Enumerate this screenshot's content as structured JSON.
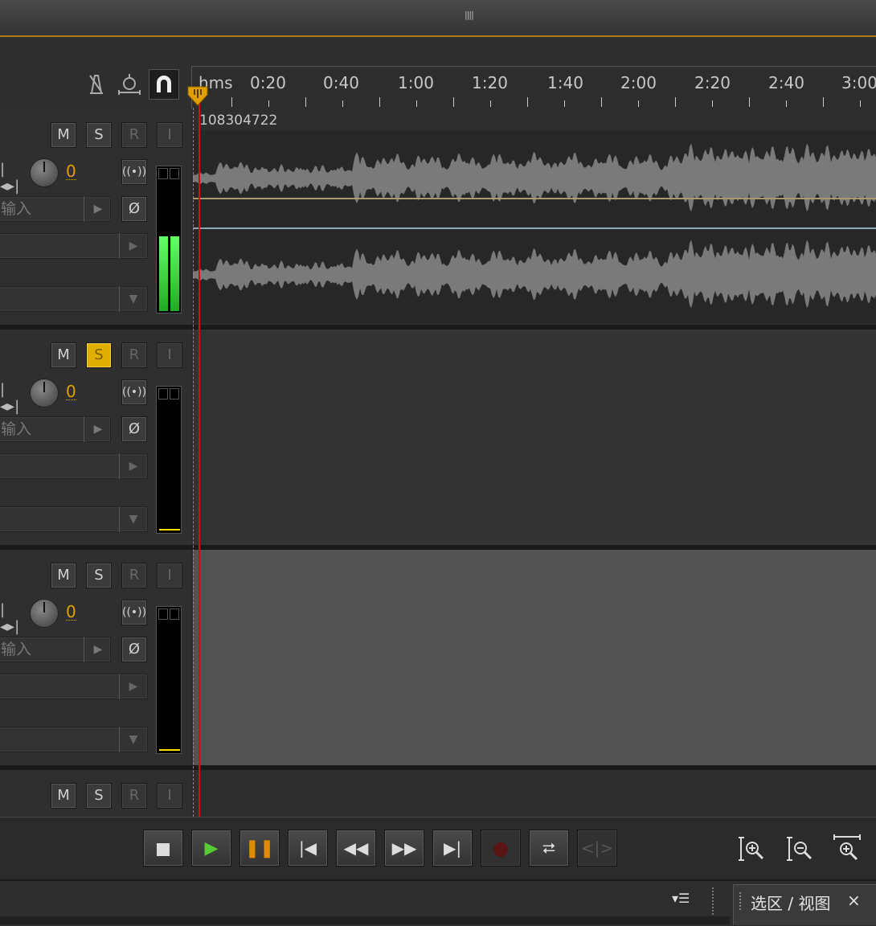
{
  "title_bar": {
    "grip_icon": "grip-icon"
  },
  "toolbar": {
    "tools": [
      "metronome-icon",
      "timeline-snap-icon",
      "magnet-icon"
    ]
  },
  "ruler": {
    "labels": [
      "hms",
      "0:20",
      "0:40",
      "1:00",
      "1:20",
      "1:40",
      "2:00",
      "2:20",
      "2:40",
      "3:00"
    ]
  },
  "tracks": [
    {
      "mute_label": "M",
      "solo_label": "S",
      "record_label": "R",
      "input_label": "I",
      "volume": "0",
      "input_placeholder": "输入",
      "solo_active": false,
      "clip_name": "108304722",
      "meter_level": 0.5
    },
    {
      "mute_label": "M",
      "solo_label": "S",
      "record_label": "R",
      "input_label": "I",
      "volume": "0",
      "input_placeholder": "输入",
      "solo_active": true,
      "meter_level": 0
    },
    {
      "mute_label": "M",
      "solo_label": "S",
      "record_label": "R",
      "input_label": "I",
      "volume": "0",
      "input_placeholder": "输入",
      "solo_active": false,
      "meter_level": 0
    },
    {
      "mute_label": "M",
      "solo_label": "S",
      "record_label": "R",
      "input_label": "I"
    }
  ],
  "transport": {
    "buttons": [
      "stop-icon",
      "play-icon",
      "pause-icon",
      "go-to-start-icon",
      "rewind-icon",
      "fast-forward-icon",
      "go-to-end-icon",
      "record-icon",
      "loop-icon",
      "skip-selection-icon"
    ]
  },
  "zoom": {
    "buttons": [
      "zoom-in-amplitude-icon",
      "zoom-out-amplitude-icon",
      "zoom-in-time-icon"
    ]
  },
  "bottom_panel": {
    "tab_label": "选区 / 视图",
    "close_symbol": "×",
    "menu_icon": "panel-menu-icon"
  },
  "colors": {
    "accent": "#e0a000",
    "playhead": "#d01010",
    "waveform": "#7a7a7a",
    "meter_green": "#33cc44"
  }
}
